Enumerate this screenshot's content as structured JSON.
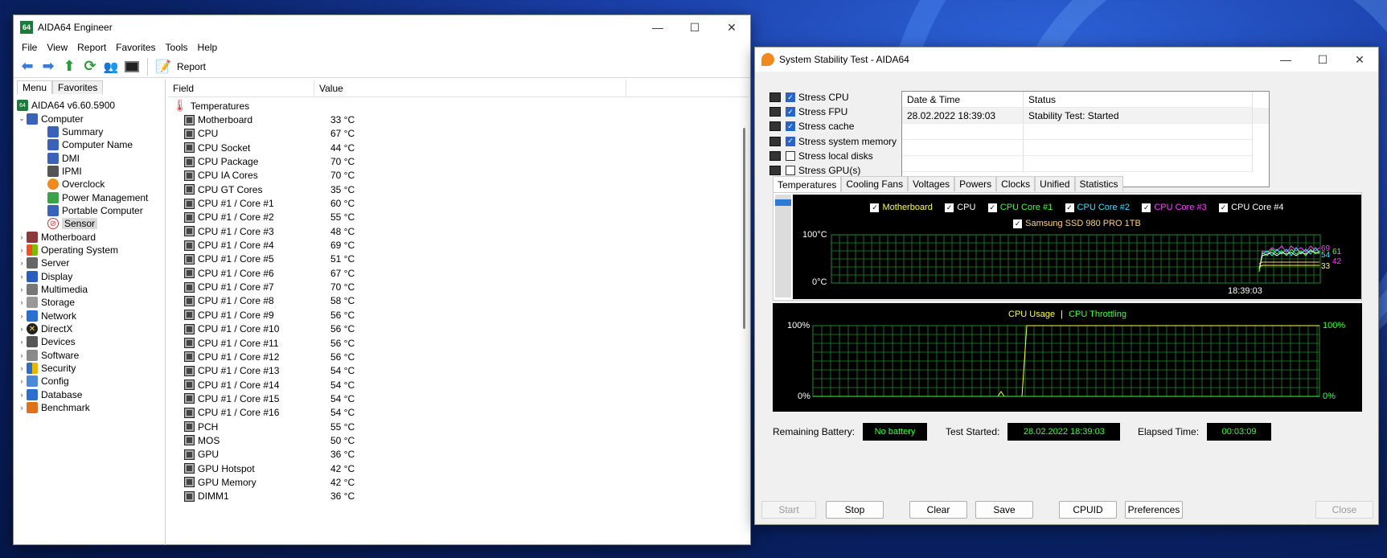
{
  "aida": {
    "title": "AIDA64 Engineer",
    "logo": "64",
    "menu": [
      "File",
      "View",
      "Report",
      "Favorites",
      "Tools",
      "Help"
    ],
    "toolbar_report": "Report",
    "left_tabs": [
      "Menu",
      "Favorites"
    ],
    "tree_root": "AIDA64 v6.60.5900",
    "tree_computer": "Computer",
    "tree_computer_children": [
      "Summary",
      "Computer Name",
      "DMI",
      "IPMI",
      "Overclock",
      "Power Management",
      "Portable Computer",
      "Sensor"
    ],
    "tree_top": [
      "Motherboard",
      "Operating System",
      "Server",
      "Display",
      "Multimedia",
      "Storage",
      "Network",
      "DirectX",
      "Devices",
      "Software",
      "Security",
      "Config",
      "Database",
      "Benchmark"
    ],
    "col_field": "Field",
    "col_value": "Value",
    "group": "Temperatures",
    "rows": [
      {
        "field": "Motherboard",
        "value": "33 °C"
      },
      {
        "field": "CPU",
        "value": "67 °C"
      },
      {
        "field": "CPU Socket",
        "value": "44 °C"
      },
      {
        "field": "CPU Package",
        "value": "70 °C"
      },
      {
        "field": "CPU IA Cores",
        "value": "70 °C"
      },
      {
        "field": "CPU GT Cores",
        "value": "35 °C"
      },
      {
        "field": "CPU #1 / Core #1",
        "value": "60 °C"
      },
      {
        "field": "CPU #1 / Core #2",
        "value": "55 °C"
      },
      {
        "field": "CPU #1 / Core #3",
        "value": "48 °C"
      },
      {
        "field": "CPU #1 / Core #4",
        "value": "69 °C"
      },
      {
        "field": "CPU #1 / Core #5",
        "value": "51 °C"
      },
      {
        "field": "CPU #1 / Core #6",
        "value": "67 °C"
      },
      {
        "field": "CPU #1 / Core #7",
        "value": "70 °C"
      },
      {
        "field": "CPU #1 / Core #8",
        "value": "58 °C"
      },
      {
        "field": "CPU #1 / Core #9",
        "value": "56 °C"
      },
      {
        "field": "CPU #1 / Core #10",
        "value": "56 °C"
      },
      {
        "field": "CPU #1 / Core #11",
        "value": "56 °C"
      },
      {
        "field": "CPU #1 / Core #12",
        "value": "56 °C"
      },
      {
        "field": "CPU #1 / Core #13",
        "value": "54 °C"
      },
      {
        "field": "CPU #1 / Core #14",
        "value": "54 °C"
      },
      {
        "field": "CPU #1 / Core #15",
        "value": "54 °C"
      },
      {
        "field": "CPU #1 / Core #16",
        "value": "54 °C"
      },
      {
        "field": "PCH",
        "value": "55 °C"
      },
      {
        "field": "MOS",
        "value": "50 °C"
      },
      {
        "field": "GPU",
        "value": "36 °C"
      },
      {
        "field": "GPU Hotspot",
        "value": "42 °C"
      },
      {
        "field": "GPU Memory",
        "value": "42 °C"
      },
      {
        "field": "DIMM1",
        "value": "36 °C"
      }
    ]
  },
  "sst": {
    "title": "System Stability Test - AIDA64",
    "stress": [
      {
        "label": "Stress CPU",
        "checked": true
      },
      {
        "label": "Stress FPU",
        "checked": true
      },
      {
        "label": "Stress cache",
        "checked": true
      },
      {
        "label": "Stress system memory",
        "checked": true
      },
      {
        "label": "Stress local disks",
        "checked": false
      },
      {
        "label": "Stress GPU(s)",
        "checked": false
      }
    ],
    "log_headers": [
      "Date & Time",
      "Status"
    ],
    "log_rows": [
      {
        "time": "28.02.2022 18:39:03",
        "status": "Stability Test: Started"
      }
    ],
    "tabs": [
      "Temperatures",
      "Cooling Fans",
      "Voltages",
      "Powers",
      "Clocks",
      "Unified",
      "Statistics"
    ],
    "temp_legend": [
      {
        "label": "Motherboard",
        "color": "#ffff40"
      },
      {
        "label": "CPU",
        "color": "#ffffff"
      },
      {
        "label": "CPU Core #1",
        "color": "#40ff40"
      },
      {
        "label": "CPU Core #2",
        "color": "#40e0ff"
      },
      {
        "label": "CPU Core #3",
        "color": "#ff40ff"
      },
      {
        "label": "CPU Core #4",
        "color": "#ffffff"
      },
      {
        "label": "Samsung SSD 980 PRO 1TB",
        "color": "#ffd27a"
      }
    ],
    "temp_ymax": "100°C",
    "temp_ymin": "0°C",
    "temp_time": "18:39:03",
    "temp_values": [
      "69",
      "61",
      "54",
      "42",
      "33"
    ],
    "usage_label": "CPU Usage",
    "usage_sep": "|",
    "throttle_label": "CPU Throttling",
    "usage_ymax": "100%",
    "usage_ymin": "0%",
    "battery_label": "Remaining Battery:",
    "battery_value": "No battery",
    "started_label": "Test Started:",
    "started_value": "28.02.2022 18:39:03",
    "elapsed_label": "Elapsed Time:",
    "elapsed_value": "00:03:09",
    "buttons": [
      "Start",
      "Stop",
      "Clear",
      "Save",
      "CPUID",
      "Preferences",
      "Close"
    ]
  }
}
